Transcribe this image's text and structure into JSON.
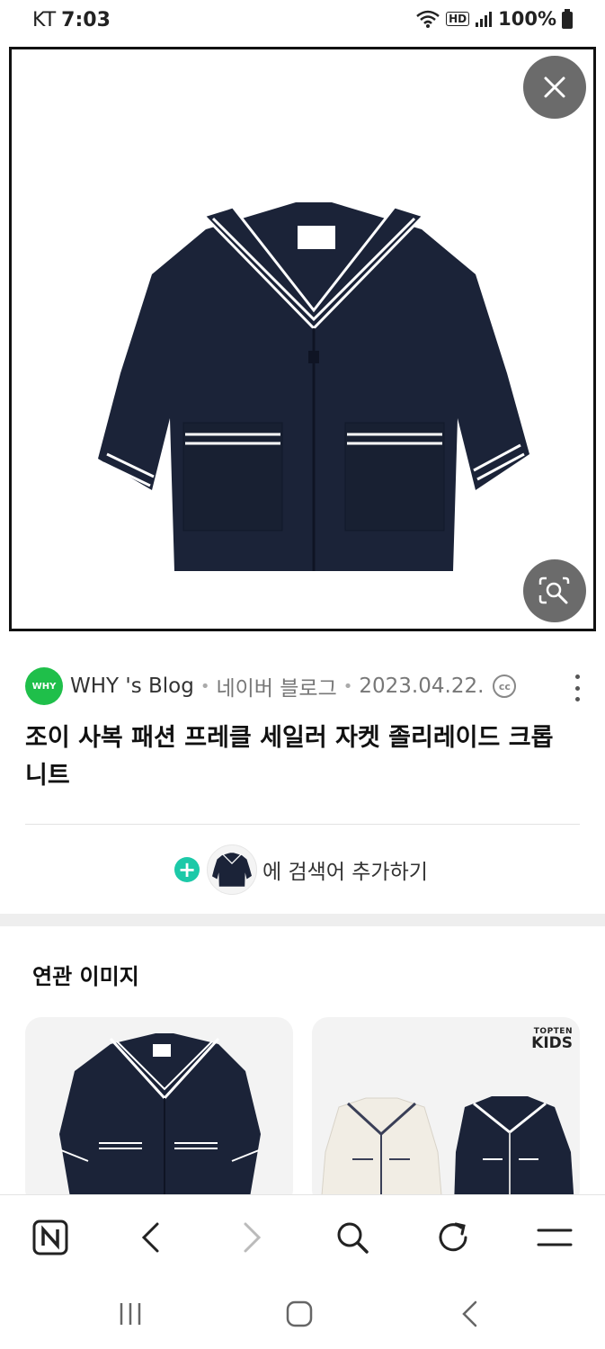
{
  "status_bar": {
    "carrier": "KT",
    "time": "7:03",
    "hd_badge": "HD",
    "battery_text": "100%",
    "icons": [
      "wifi-6-icon",
      "hd-voice-icon",
      "signal-icon",
      "battery-icon"
    ]
  },
  "viewer": {
    "close_icon": "close-icon",
    "lens_icon": "image-search-icon",
    "image_subject": "navy sailor collar jacket"
  },
  "source": {
    "logo_text": "WHY",
    "blog_name": "WHY 's Blog",
    "platform": "네이버 블로그",
    "date": "2023.04.22.",
    "license_icon": "cc-icon",
    "license_text": "cc"
  },
  "title": "조이 사복 패션 프레클 세일러 자켓 졸리레이드 크롭 니트",
  "add_search": {
    "plus_symbol": "+",
    "text": "에 검색어 추가하기"
  },
  "related": {
    "heading": "연관 이미지",
    "cards": [
      {
        "type": "navy sailor jacket"
      },
      {
        "type": "cream and navy sailor cardigans",
        "brand_top": "TOPTEN",
        "brand_bottom": "KIDS"
      }
    ]
  },
  "bottom_nav": {
    "items": [
      "naver-home-icon",
      "back-icon",
      "forward-icon",
      "search-icon",
      "refresh-icon",
      "menu-icon"
    ]
  },
  "system_nav": {
    "items": [
      "recent-apps-icon",
      "home-icon",
      "system-back-icon"
    ]
  },
  "colors": {
    "overlay_button": "#6b6b6b",
    "logo_green": "#1fbf4a",
    "plus_teal": "#1cc9a8",
    "jacket_navy": "#1b2338"
  }
}
